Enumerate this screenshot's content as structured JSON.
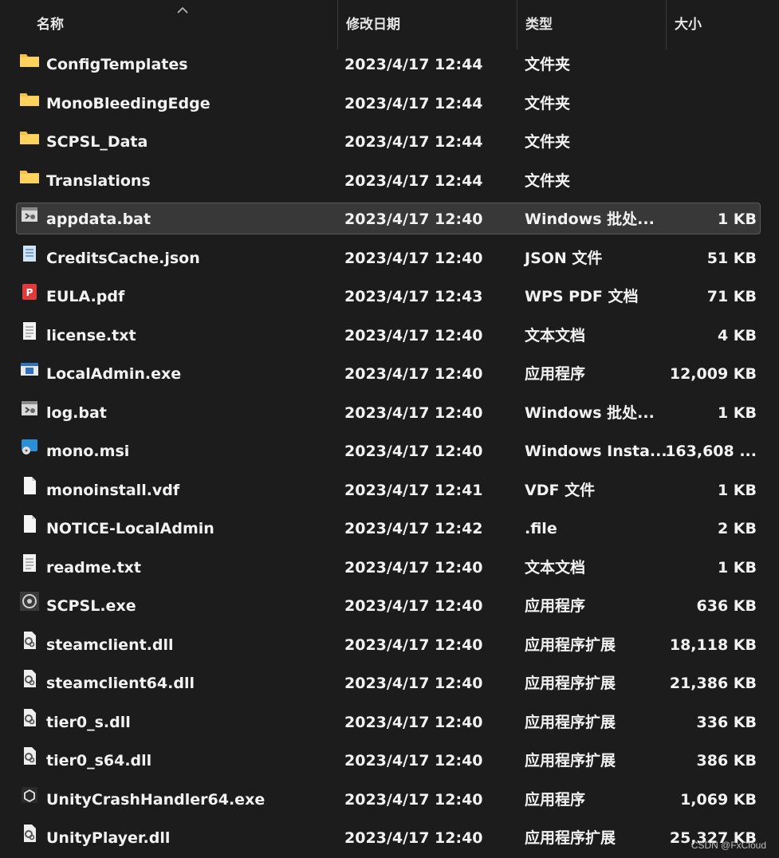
{
  "header": {
    "name": "名称",
    "date": "修改日期",
    "type": "类型",
    "size": "大小"
  },
  "files": [
    {
      "name": "ConfigTemplates",
      "date": "2023/4/17 12:44",
      "type": "文件夹",
      "size": "",
      "icon": "folder-icon"
    },
    {
      "name": "MonoBleedingEdge",
      "date": "2023/4/17 12:44",
      "type": "文件夹",
      "size": "",
      "icon": "folder-icon"
    },
    {
      "name": "SCPSL_Data",
      "date": "2023/4/17 12:44",
      "type": "文件夹",
      "size": "",
      "icon": "folder-icon"
    },
    {
      "name": "Translations",
      "date": "2023/4/17 12:44",
      "type": "文件夹",
      "size": "",
      "icon": "folder-icon"
    },
    {
      "name": "appdata.bat",
      "date": "2023/4/17 12:40",
      "type": "Windows 批处...",
      "size": "1 KB",
      "icon": "batch-file-icon",
      "selected": true
    },
    {
      "name": "CreditsCache.json",
      "date": "2023/4/17 12:40",
      "type": "JSON 文件",
      "size": "51 KB",
      "icon": "json-file-icon"
    },
    {
      "name": "EULA.pdf",
      "date": "2023/4/17 12:43",
      "type": "WPS PDF 文档",
      "size": "71 KB",
      "icon": "pdf-file-icon"
    },
    {
      "name": "license.txt",
      "date": "2023/4/17 12:40",
      "type": "文本文档",
      "size": "4 KB",
      "icon": "text-file-icon"
    },
    {
      "name": "LocalAdmin.exe",
      "date": "2023/4/17 12:40",
      "type": "应用程序",
      "size": "12,009 KB",
      "icon": "app-window-icon"
    },
    {
      "name": "log.bat",
      "date": "2023/4/17 12:40",
      "type": "Windows 批处...",
      "size": "1 KB",
      "icon": "batch-file-icon"
    },
    {
      "name": "mono.msi",
      "date": "2023/4/17 12:40",
      "type": "Windows Insta...",
      "size": "163,608 ...",
      "icon": "installer-icon"
    },
    {
      "name": "monoinstall.vdf",
      "date": "2023/4/17 12:41",
      "type": "VDF 文件",
      "size": "1 KB",
      "icon": "blank-file-icon"
    },
    {
      "name": "NOTICE-LocalAdmin",
      "date": "2023/4/17 12:42",
      "type": ".file",
      "size": "2 KB",
      "icon": "blank-file-icon"
    },
    {
      "name": "readme.txt",
      "date": "2023/4/17 12:40",
      "type": "文本文档",
      "size": "1 KB",
      "icon": "text-file-icon"
    },
    {
      "name": "SCPSL.exe",
      "date": "2023/4/17 12:40",
      "type": "应用程序",
      "size": "636 KB",
      "icon": "scp-logo-icon"
    },
    {
      "name": "steamclient.dll",
      "date": "2023/4/17 12:40",
      "type": "应用程序扩展",
      "size": "18,118 KB",
      "icon": "dll-file-icon"
    },
    {
      "name": "steamclient64.dll",
      "date": "2023/4/17 12:40",
      "type": "应用程序扩展",
      "size": "21,386 KB",
      "icon": "dll-file-icon"
    },
    {
      "name": "tier0_s.dll",
      "date": "2023/4/17 12:40",
      "type": "应用程序扩展",
      "size": "336 KB",
      "icon": "dll-file-icon"
    },
    {
      "name": "tier0_s64.dll",
      "date": "2023/4/17 12:40",
      "type": "应用程序扩展",
      "size": "386 KB",
      "icon": "dll-file-icon"
    },
    {
      "name": "UnityCrashHandler64.exe",
      "date": "2023/4/17 12:40",
      "type": "应用程序",
      "size": "1,069 KB",
      "icon": "unity-icon"
    },
    {
      "name": "UnityPlayer.dll",
      "date": "2023/4/17 12:40",
      "type": "应用程序扩展",
      "size": "25,327 KB",
      "icon": "dll-file-icon"
    }
  ],
  "watermark": "CSDN @FxCloud",
  "colors": {
    "background": "#1c1c1c",
    "selected_row": "#383838",
    "folder": "#f5c04a",
    "pdf": "#e03b3b"
  }
}
